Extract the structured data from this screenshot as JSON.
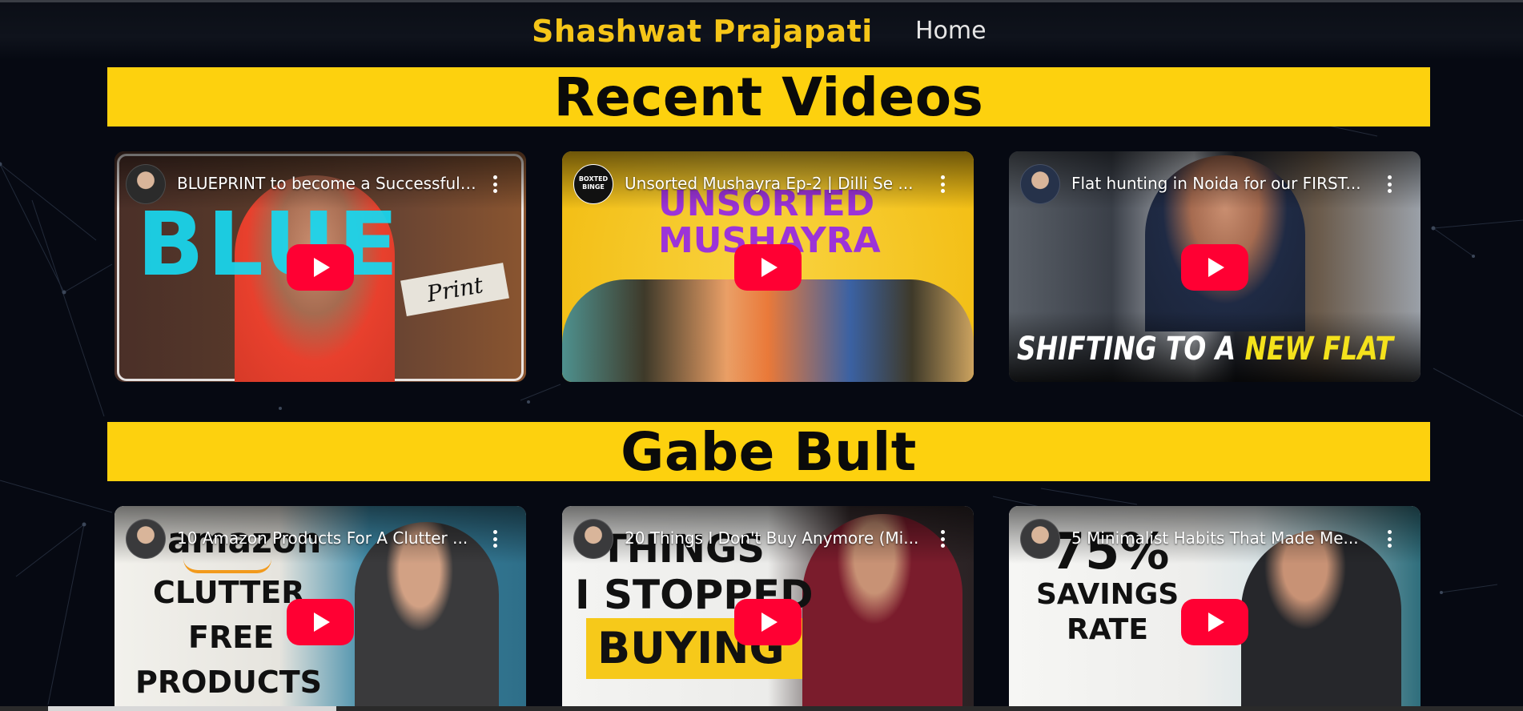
{
  "navbar": {
    "brand": "Shashwat Prajapati",
    "home_link": "Home"
  },
  "colors": {
    "accent": "#fdd10e",
    "background": "#060912",
    "play_button": "#ff0033"
  },
  "sections": [
    {
      "heading": "Recent Videos",
      "videos": [
        {
          "title": "BLUEPRINT to become a Successful Content Creator",
          "thumb_words": [
            "BLUE",
            "Print"
          ]
        },
        {
          "title": "Unsorted Mushayra Ep-2 | Dilli Se ...",
          "thumb_words": [
            "UNSORTED",
            "MUSHAYRA"
          ],
          "channel_badge": "BOXTED BINGE"
        },
        {
          "title": "Flat hunting in Noida for our FIRST...",
          "thumb_words": [
            "SHIFTING TO A",
            "NEW FLAT"
          ]
        }
      ]
    },
    {
      "heading": "Gabe Bult",
      "videos": [
        {
          "title": "10 Amazon Products For A Clutter ...",
          "thumb_words": [
            "amazon",
            "CLUTTER",
            "FREE",
            "PRODUCTS"
          ]
        },
        {
          "title": "20 Things I Don't Buy Anymore (Mi...",
          "thumb_words": [
            "THINGS",
            "I STOPPED",
            "BUYING"
          ]
        },
        {
          "title": "5 Minimalist Habits That Made Me...",
          "thumb_words": [
            "75%",
            "SAVINGS",
            "RATE"
          ]
        }
      ]
    }
  ],
  "icons": {
    "play": "play-button-icon",
    "more": "more-options-icon",
    "avatar": "channel-avatar"
  }
}
